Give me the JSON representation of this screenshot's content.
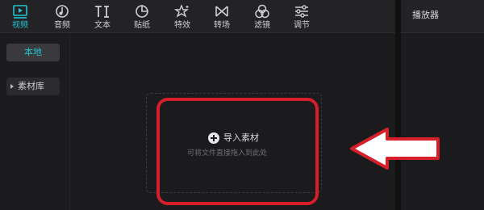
{
  "toolbar": {
    "items": [
      {
        "label": "视频",
        "icon": "video-icon",
        "active": true
      },
      {
        "label": "音频",
        "icon": "audio-icon"
      },
      {
        "label": "文本",
        "icon": "text-icon"
      },
      {
        "label": "贴纸",
        "icon": "sticker-icon"
      },
      {
        "label": "特效",
        "icon": "effects-icon"
      },
      {
        "label": "转场",
        "icon": "transition-icon"
      },
      {
        "label": "滤镜",
        "icon": "filter-icon"
      },
      {
        "label": "调节",
        "icon": "adjust-icon"
      }
    ]
  },
  "sidebar": {
    "local_label": "本地",
    "library_label": "素材库"
  },
  "dropzone": {
    "import_label": "导入素材",
    "hint": "可将文件直接拖入到此处"
  },
  "player": {
    "title": "播放器"
  },
  "colors": {
    "accent": "#21c3cf",
    "highlight": "#d51f2b"
  }
}
